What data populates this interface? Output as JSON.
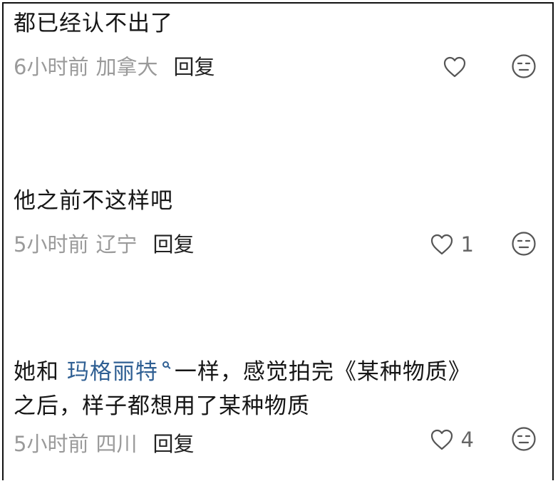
{
  "comments": [
    {
      "text": "都已经认不出了",
      "time": "6小时前",
      "location": "加拿大",
      "reply_label": "回复",
      "likes": ""
    },
    {
      "text": "他之前不这样吧",
      "time": "5小时前",
      "location": "辽宁",
      "reply_label": "回复",
      "likes": "1"
    },
    {
      "text_before": "她和 ",
      "mention": "玛格丽特",
      "text_after_line1": "一样，感觉拍完《某种物质》",
      "text_line2": "之后，样子都想用了某种物质",
      "time": "5小时前",
      "location": "四川",
      "reply_label": "回复",
      "likes": "4"
    }
  ],
  "icons": {
    "like": "heart-outline-icon",
    "dislike": "meh-face-icon",
    "mention_search": "search-icon"
  },
  "colors": {
    "text": "#161616",
    "meta": "#9a9a9a",
    "mention": "#2f5f93",
    "icon": "#555555"
  }
}
